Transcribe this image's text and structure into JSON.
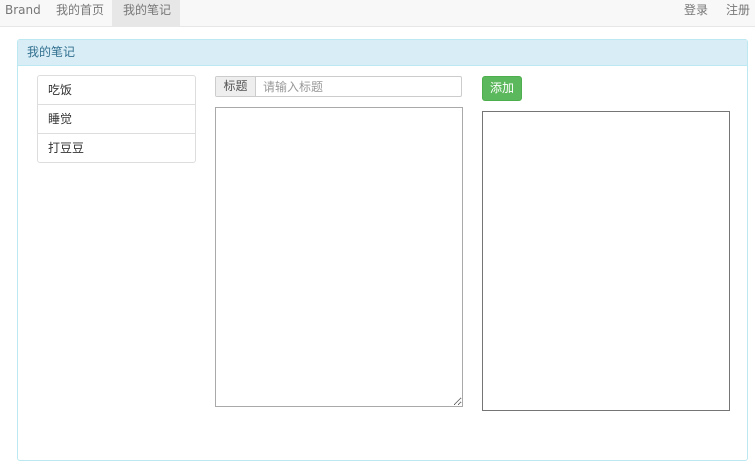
{
  "navbar": {
    "brand": "Brand",
    "items": [
      {
        "label": "我的首页",
        "active": false
      },
      {
        "label": "我的笔记",
        "active": true
      }
    ],
    "right_items": [
      {
        "label": "登录"
      },
      {
        "label": "注册"
      }
    ]
  },
  "panel": {
    "heading": "我的笔记",
    "notes": [
      {
        "label": "吃饭"
      },
      {
        "label": "睡觉"
      },
      {
        "label": "打豆豆"
      }
    ],
    "title_addon": "标题",
    "title_value": "",
    "title_placeholder": "请输入标题",
    "content_value": "",
    "add_label": "添加",
    "preview_text": ""
  },
  "colors": {
    "panel_heading_bg": "#d9edf7",
    "panel_heading_text": "#31708f",
    "panel_border": "#bce8f1",
    "success": "#5cb85c",
    "navbar_bg": "#f8f8f8",
    "nav_active_bg": "#e7e7e7"
  }
}
